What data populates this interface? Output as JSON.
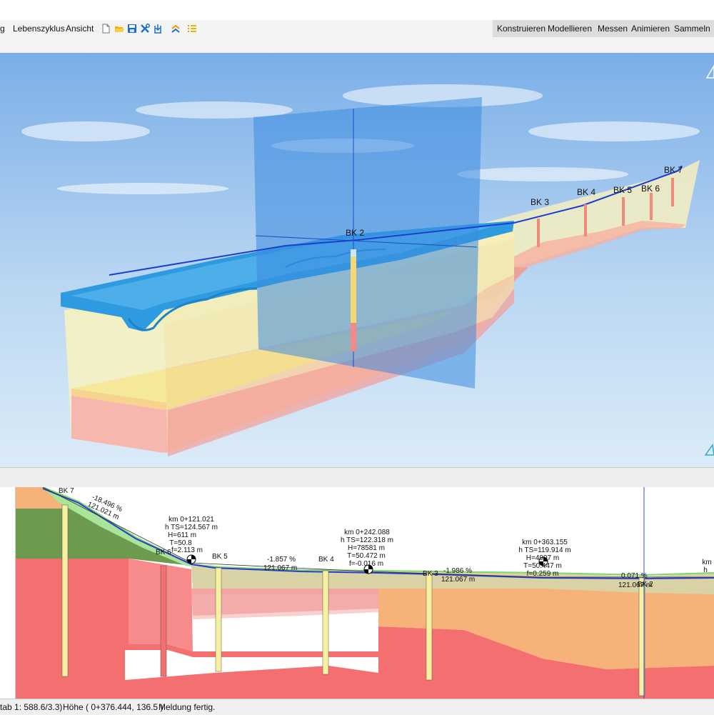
{
  "menu": {
    "items": [
      {
        "label": "g"
      },
      {
        "label": "Lebenszyklus"
      },
      {
        "label": "Ansicht"
      }
    ],
    "right_items": [
      {
        "label": "Konstruieren"
      },
      {
        "label": "Modellieren"
      },
      {
        "label": "Messen"
      },
      {
        "label": "Animieren"
      },
      {
        "label": "Sammeln"
      }
    ]
  },
  "toolbar": {
    "icons": [
      "new-file-icon",
      "open-folder-icon",
      "save-icon",
      "tools-icon",
      "import-icon",
      "chevrons-up-icon",
      "list-icon"
    ],
    "colors": {
      "folder": "#f0b400",
      "blue": "#1a6fc7"
    }
  },
  "view3d": {
    "borehole_labels": [
      "BK 2",
      "BK 3",
      "BK 4",
      "BK 5",
      "BK 6",
      "BK 7"
    ],
    "colors": {
      "sky_top": "#7aaee8",
      "sky_bottom": "#d4e6f6",
      "water": "#2e9be0",
      "axis_line": "#1a3fd0"
    }
  },
  "section": {
    "borehole_labels": [
      "BK 7",
      "BK 6",
      "BK 5",
      "BK 4",
      "BK 3",
      "BK 2"
    ],
    "grades": [
      {
        "percent": "-18.496 %",
        "length": "121.021 m"
      },
      {
        "percent": "-1.857 %",
        "length": "121.067 m"
      },
      {
        "percent": "-1.986 %",
        "length": "121.067 m"
      },
      {
        "percent": "0.071 %",
        "length": "121.067 m"
      }
    ],
    "stations": [
      {
        "km": "km 0+121.021",
        "ts": "h TS=124.567 m",
        "h": "H=611 m",
        "t": "T=50.8",
        "f": "f=2.113 m"
      },
      {
        "km": "km 0+242.088",
        "ts": "h TS=122.318 m",
        "h": "H=78581 m",
        "t": "T=50.472 m",
        "f": "f=-0.016 m"
      },
      {
        "km": "km 0+363.155",
        "ts": "h TS=119.914 m",
        "h": "H=4907 m",
        "t": "T=50.447 m",
        "f": "f=0.259 m"
      },
      {
        "km": "km",
        "ts": "h"
      }
    ],
    "colors": {
      "red": "#f47070",
      "orange": "#f7b27a",
      "green": "#6e9a50",
      "khaki": "#d8d2a4",
      "profile": "#2a3dd0",
      "terrain": "#9ee08a"
    }
  },
  "status": {
    "scale": "tab  1: 588.6/3.3)",
    "height": "Höhe  ( 0+376.444, 136.5 )",
    "message": "Meldung  fertig."
  }
}
